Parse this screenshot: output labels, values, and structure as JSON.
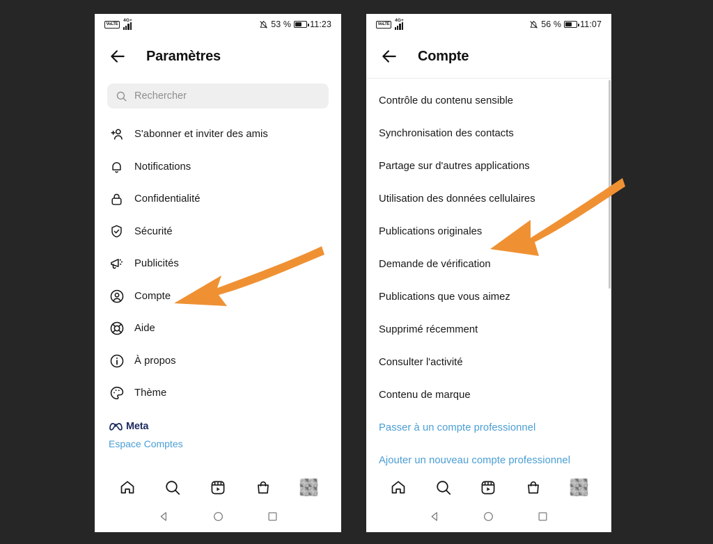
{
  "theme": {
    "page_background": "#262626",
    "screen_background": "#ffffff",
    "text_primary": "#171717",
    "link_blue": "#4a9ed4",
    "meta_blue": "#1c2b5e",
    "arrow_orange": "#ef9133",
    "search_field_background": "#efefef",
    "placeholder_gray": "#8e8e8e"
  },
  "left_phone": {
    "status_bar": {
      "carrier_badge": "VoLTE",
      "network_type": "4G+",
      "signal_icon": "signal-bars-icon",
      "silent_icon": "bell-muted-icon",
      "battery_percent": "53 %",
      "battery_icon": "battery-icon",
      "clock": "11:23"
    },
    "header": {
      "back_icon": "back-arrow-icon",
      "title": "Paramètres"
    },
    "search": {
      "icon": "search-icon",
      "placeholder": "Rechercher",
      "value": ""
    },
    "items": [
      {
        "label": "S'abonner et inviter des amis",
        "icon": "add-person-icon"
      },
      {
        "label": "Notifications",
        "icon": "bell-icon"
      },
      {
        "label": "Confidentialité",
        "icon": "lock-icon"
      },
      {
        "label": "Sécurité",
        "icon": "shield-check-icon"
      },
      {
        "label": "Publicités",
        "icon": "megaphone-icon"
      },
      {
        "label": "Compte",
        "icon": "person-circle-icon"
      },
      {
        "label": "Aide",
        "icon": "lifebuoy-icon"
      },
      {
        "label": "À propos",
        "icon": "info-circle-icon"
      },
      {
        "label": "Thème",
        "icon": "palette-icon"
      }
    ],
    "footer": {
      "meta_logo_icon": "meta-infinity-icon",
      "meta_label": "Meta",
      "accounts_center_link": "Espace Comptes"
    },
    "bottom_nav": [
      {
        "icon": "home-icon",
        "name": "nav-home"
      },
      {
        "icon": "search-icon",
        "name": "nav-search"
      },
      {
        "icon": "reels-icon",
        "name": "nav-reels"
      },
      {
        "icon": "shop-bag-icon",
        "name": "nav-shop"
      },
      {
        "icon": "profile-avatar",
        "name": "nav-profile"
      }
    ],
    "android_nav": [
      {
        "icon": "back-triangle-icon",
        "name": "android-back"
      },
      {
        "icon": "home-circle-icon",
        "name": "android-home"
      },
      {
        "icon": "recents-square-icon",
        "name": "android-recents"
      }
    ]
  },
  "right_phone": {
    "status_bar": {
      "carrier_badge": "VoLTE",
      "network_type": "4G+",
      "signal_icon": "signal-bars-icon",
      "silent_icon": "bell-muted-icon",
      "battery_percent": "56 %",
      "battery_icon": "battery-icon",
      "clock": "11:07"
    },
    "header": {
      "back_icon": "back-arrow-icon",
      "title": "Compte"
    },
    "items": [
      {
        "label": "Contrôle du contenu sensible",
        "style": "normal"
      },
      {
        "label": "Synchronisation des contacts",
        "style": "normal"
      },
      {
        "label": "Partage sur d'autres applications",
        "style": "normal"
      },
      {
        "label": "Utilisation des données cellulaires",
        "style": "normal"
      },
      {
        "label": "Publications originales",
        "style": "normal"
      },
      {
        "label": "Demande de vérification",
        "style": "normal"
      },
      {
        "label": "Publications que vous aimez",
        "style": "normal"
      },
      {
        "label": "Supprimé récemment",
        "style": "normal"
      },
      {
        "label": "Consulter l'activité",
        "style": "normal"
      },
      {
        "label": "Contenu de marque",
        "style": "normal"
      },
      {
        "label": "Passer à un compte professionnel",
        "style": "link"
      },
      {
        "label": "Ajouter un nouveau compte professionnel",
        "style": "link"
      }
    ],
    "bottom_nav": [
      {
        "icon": "home-icon",
        "name": "nav-home"
      },
      {
        "icon": "search-icon",
        "name": "nav-search"
      },
      {
        "icon": "reels-icon",
        "name": "nav-reels"
      },
      {
        "icon": "shop-bag-icon",
        "name": "nav-shop"
      },
      {
        "icon": "profile-avatar",
        "name": "nav-profile"
      }
    ],
    "android_nav": [
      {
        "icon": "back-triangle-icon",
        "name": "android-back"
      },
      {
        "icon": "home-circle-icon",
        "name": "android-home"
      },
      {
        "icon": "recents-square-icon",
        "name": "android-recents"
      }
    ]
  },
  "annotations": [
    {
      "name": "arrow-pointing-to-compte",
      "icon": "orange-arrow-icon",
      "target": "Compte"
    },
    {
      "name": "arrow-pointing-to-demande-de-verification",
      "icon": "orange-arrow-icon",
      "target": "Demande de vérification"
    }
  ]
}
